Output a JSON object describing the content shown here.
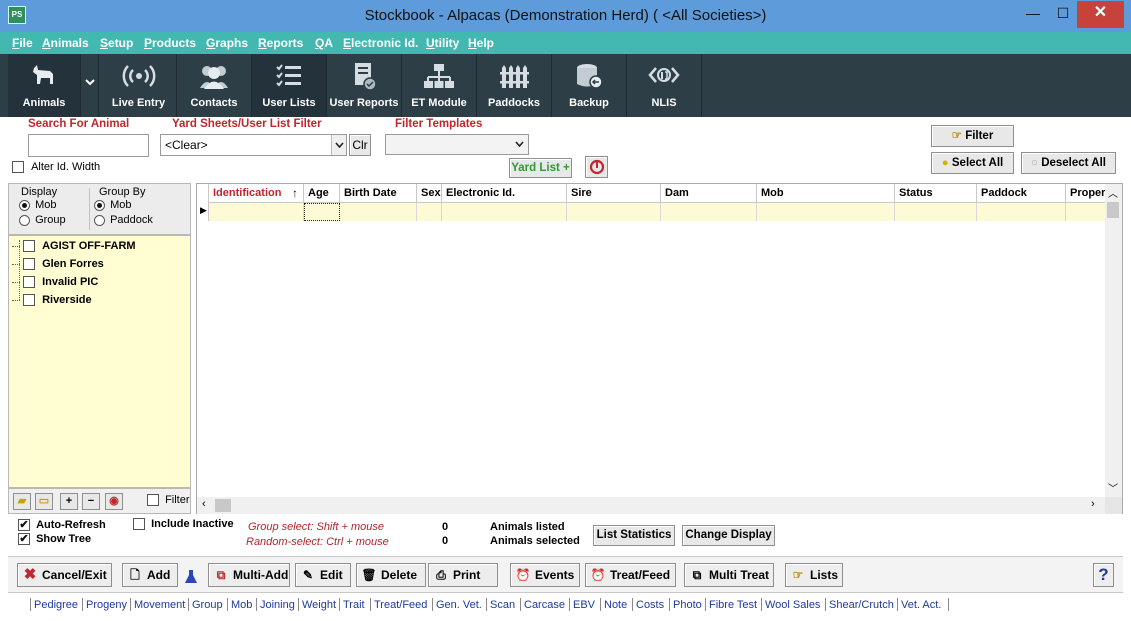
{
  "window": {
    "title": "Stockbook - Alpacas (Demonstration Herd) ( <All Societies>)",
    "icon_text": "PS",
    "min": "—",
    "max": "☐",
    "close": "✕"
  },
  "menu": [
    "File",
    "Animals",
    "Setup",
    "Products",
    "Graphs",
    "Reports",
    "QA",
    "Electronic Id.",
    "Utility",
    "Help"
  ],
  "toolbar": [
    {
      "label": "Animals",
      "icon": "alpaca-icon"
    },
    {
      "label": "Live Entry",
      "icon": "broadcast-icon"
    },
    {
      "label": "Contacts",
      "icon": "contacts-icon"
    },
    {
      "label": "User Lists",
      "icon": "checklist-icon"
    },
    {
      "label": "User Reports",
      "icon": "report-icon"
    },
    {
      "label": "ET Module",
      "icon": "hierarchy-icon"
    },
    {
      "label": "Paddocks",
      "icon": "fence-icon"
    },
    {
      "label": "Backup",
      "icon": "database-icon"
    },
    {
      "label": "NLIS",
      "icon": "nlis-icon"
    }
  ],
  "search": {
    "search_label": "Search For Animal",
    "search_value": "",
    "alter_id_label": "Alter Id. Width",
    "yard_label": "Yard Sheets/User List Filter",
    "yard_value": "<Clear>",
    "clr_label": "Clr",
    "templates_label": "Filter Templates",
    "templates_value": "",
    "yard_list_label": "Yard List +"
  },
  "right_buttons": {
    "filter": "Filter",
    "select_all": "Select All",
    "deselect_all": "Deselect All"
  },
  "display": {
    "display_label": "Display",
    "mob": "Mob",
    "group": "Group",
    "group_by_label": "Group By",
    "gb_mob": "Mob",
    "gb_paddock": "Paddock"
  },
  "tree": [
    "AGIST OFF-FARM",
    "Glen Forres",
    "Invalid PIC",
    "Riverside"
  ],
  "tree_tools": {
    "filter_label": "Filter"
  },
  "grid": {
    "sort_arrow": "↑",
    "columns": [
      "Identification",
      "Age",
      "Birth Date",
      "Sex",
      "Electronic Id.",
      "Sire",
      "Dam",
      "Mob",
      "Status",
      "Paddock",
      "Proper"
    ]
  },
  "status": {
    "auto_refresh": "Auto-Refresh",
    "show_tree": "Show Tree",
    "include_inactive": "Include Inactive",
    "group_select": "Group select: Shift + mouse",
    "random_select": "Random-select: Ctrl + mouse",
    "listed_count": "0",
    "selected_count": "0",
    "animals_listed": "Animals listed",
    "animals_selected": "Animals selected",
    "list_statistics": "List Statistics",
    "change_display": "Change Display"
  },
  "actions": {
    "cancel_exit": "Cancel/Exit",
    "add": "Add",
    "multi_add": "Multi-Add",
    "edit": "Edit",
    "delete": "Delete",
    "print": "Print",
    "events": "Events",
    "treat_feed": "Treat/Feed",
    "multi_treat": "Multi Treat",
    "lists": "Lists",
    "help": "?"
  },
  "links": [
    "Pedigree",
    "Progeny",
    "Movement",
    "Group",
    "Mob",
    "Joining",
    "Weight",
    "Trait",
    "Treat/Feed",
    "Gen. Vet.",
    "Scan",
    "Carcase",
    "EBV",
    "Note",
    "Costs",
    "Photo",
    "Fibre Test",
    "Wool Sales",
    "Shear/Crutch",
    "Vet. Act."
  ],
  "colors": {
    "titlebar": "#5e9bdb",
    "menubar": "#43b8b1",
    "toolbar": "#2d3e47",
    "label_red": "#c0262d",
    "row_yellow": "#fdfbd5"
  }
}
